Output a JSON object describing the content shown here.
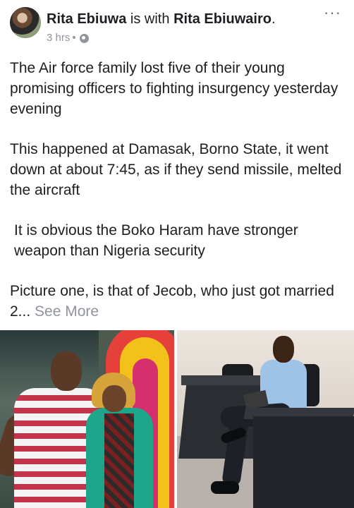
{
  "post": {
    "author": "Rita Ebiuwa",
    "with_text": "is with",
    "tagged": "Rita Ebiuwairo",
    "time": "3 hrs",
    "time_separator": "•",
    "privacy_icon": "globe-icon",
    "more_icon": "more-options-icon",
    "paragraphs": [
      "The Air force family lost five of their young promising officers to fighting insurgency yesterday evening",
      "This happened at Damasak, Borno State, it went down at about 7:45, as if they send missile, melted the aircraft",
      "It is obvious the Boko Haram have stronger weapon than Nigeria security"
    ],
    "last_paragraph": "Picture one, is that of Jecob, who  just got married 2...",
    "see_more": "See More"
  },
  "colors": {
    "text": "#1c1e21",
    "meta": "#90949c"
  }
}
